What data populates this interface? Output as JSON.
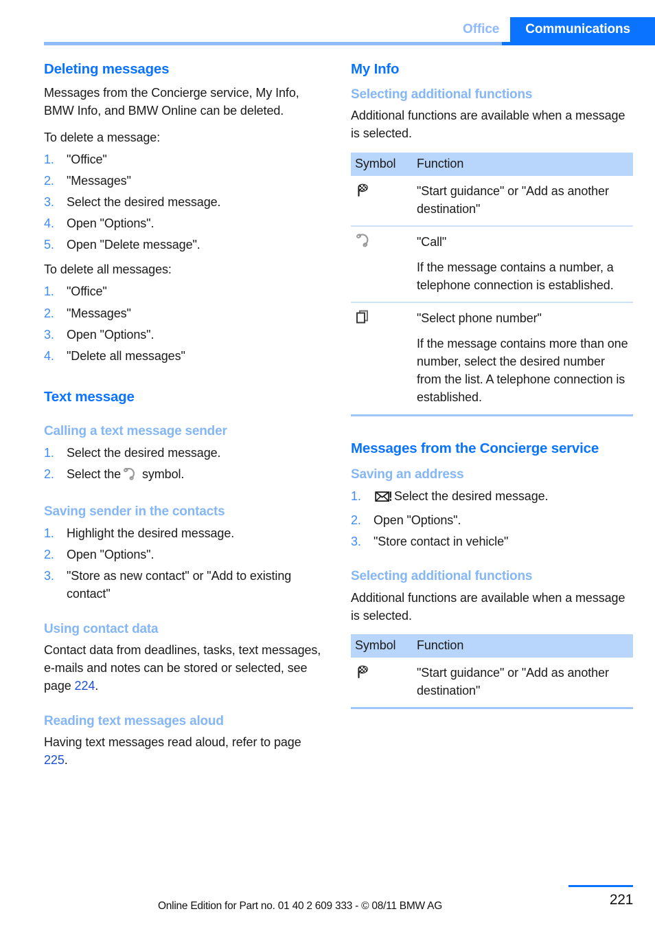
{
  "header": {
    "tab_office": "Office",
    "tab_communications": "Communications",
    "accent_color": "#0a73ff",
    "muted_accent_color": "#8fb9ff"
  },
  "left_column": {
    "deleting": {
      "heading": "Deleting messages",
      "intro": "Messages from the Concierge service, My Info, BMW Info, and BMW Online can be deleted.",
      "lead_one": "To delete a message:",
      "steps_one": [
        "\"Office\"",
        "\"Messages\"",
        "Select the desired message.",
        "Open \"Options\".",
        "Open \"Delete message\"."
      ],
      "lead_all": "To delete all messages:",
      "steps_all": [
        "\"Office\"",
        "\"Messages\"",
        "Open \"Options\".",
        "\"Delete all messages\""
      ]
    },
    "text_message": {
      "heading": "Text message",
      "calling": {
        "heading": "Calling a text message sender",
        "step_1": "Select the desired message.",
        "step_2_before": "Select the",
        "step_2_after": "symbol."
      },
      "saving_sender": {
        "heading": "Saving sender in the contacts",
        "steps": [
          "Highlight the desired message.",
          "Open \"Options\".",
          "\"Store as new contact\" or \"Add to existing contact\""
        ]
      },
      "contact_data": {
        "heading": "Using contact data",
        "text_before": "Contact data from deadlines, tasks, text messages, e-mails and notes can be stored or selected, see page ",
        "page_ref": "224",
        "text_after": "."
      },
      "reading_aloud": {
        "heading": "Reading text messages aloud",
        "text_before": "Having text messages read aloud, refer to page ",
        "page_ref": "225",
        "text_after": "."
      }
    }
  },
  "right_column": {
    "my_info": {
      "heading": "My Info",
      "additional": {
        "heading": "Selecting additional functions",
        "intro": "Additional functions are available when a message is selected.",
        "table": {
          "col_symbol": "Symbol",
          "col_function": "Function",
          "rows": [
            {
              "icon": "checkered-flag-icon",
              "lines": [
                "\"Start guidance\" or \"Add as another destination\""
              ]
            },
            {
              "icon": "phone-handset-icon",
              "lines": [
                "\"Call\"",
                "If the message contains a number, a telephone connection is established."
              ]
            },
            {
              "icon": "list-pages-icon",
              "lines": [
                "\"Select phone number\"",
                "If the message contains more than one number, select the desired number from the list. A telephone connection is established."
              ]
            }
          ]
        }
      }
    },
    "concierge": {
      "heading": "Messages from the Concierge service",
      "saving_address": {
        "heading": "Saving an address",
        "step_1_icon": "envelope-alert-icon",
        "step_1_text": "Select the desired message.",
        "step_2": "Open \"Options\".",
        "step_3": "\"Store contact in vehicle\""
      },
      "additional": {
        "heading": "Selecting additional functions",
        "intro": "Additional functions are available when a message is selected.",
        "table": {
          "col_symbol": "Symbol",
          "col_function": "Function",
          "rows": [
            {
              "icon": "checkered-flag-icon",
              "lines": [
                "\"Start guidance\" or \"Add as another destination\""
              ]
            }
          ]
        }
      }
    }
  },
  "footer": {
    "edition_text": "Online Edition for Part no. 01 40 2 609 333 - © 08/11 BMW AG",
    "page_number": "221"
  }
}
